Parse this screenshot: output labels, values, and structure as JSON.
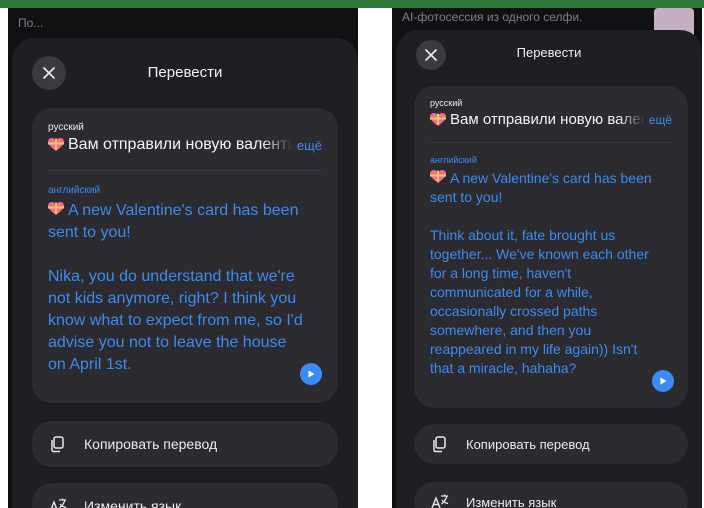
{
  "left": {
    "background_text": "По...",
    "header": {
      "title": "Перевести"
    },
    "source": {
      "language": "русский",
      "text": "Вам отправили новую валентинку!",
      "more_label": "ещё"
    },
    "target": {
      "language": "английский",
      "paragraphs": [
        "A new Valentine's card has been sent to you!",
        "Nika, you do understand that we're not kids anymore, right? I think you know what to expect from me, so I'd advise you not to leave the house on April 1st."
      ]
    },
    "actions": [
      {
        "label": "Копировать перевод",
        "icon": "copy-icon"
      },
      {
        "label": "Изменить язык",
        "icon": "translate-icon"
      }
    ]
  },
  "right": {
    "background_text": "AI-фотосессия из одного селфи.",
    "header": {
      "title": "Перевести"
    },
    "source": {
      "language": "русский",
      "text": "Вам отправили новую валентинку!",
      "more_label": "ещё"
    },
    "target": {
      "language": "английский",
      "paragraphs": [
        "A new Valentine's card has been sent to you!",
        "Think about it, fate brought us together... We've known each other for a long time, haven't communicated for a while, occasionally crossed paths somewhere, and then you reappeared in my life again)) Isn't that a miracle, hahaha?"
      ]
    },
    "actions": [
      {
        "label": "Копировать перевод",
        "icon": "copy-icon"
      },
      {
        "label": "Изменить язык",
        "icon": "translate-icon"
      }
    ]
  },
  "colors": {
    "accent": "#3d8bf2",
    "sheet": "#1f1f23",
    "card": "#2b2b30",
    "top_bar": "#2f7a3a"
  }
}
